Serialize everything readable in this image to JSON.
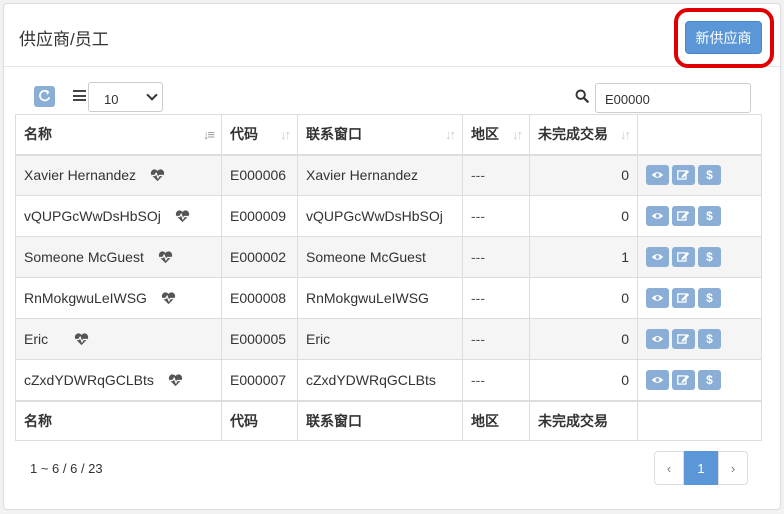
{
  "header": {
    "title": "供应商/员工",
    "new_button": "新供应商"
  },
  "toolbar": {
    "page_size": "10",
    "search_value": "E00000"
  },
  "table": {
    "columns": [
      "名称",
      "代码",
      "联系窗口",
      "地区",
      "未完成交易"
    ],
    "rows": [
      {
        "name": "Xavier Hernandez",
        "code": "E000006",
        "contact": "Xavier Hernandez",
        "region": "---",
        "open": "0"
      },
      {
        "name": "vQUPGcWwDsHbSOj",
        "code": "E000009",
        "contact": "vQUPGcWwDsHbSOj",
        "region": "---",
        "open": "0"
      },
      {
        "name": "Someone McGuest",
        "code": "E000002",
        "contact": "Someone McGuest",
        "region": "---",
        "open": "1"
      },
      {
        "name": "RnMokgwuLeIWSG",
        "code": "E000008",
        "contact": "RnMokgwuLeIWSG",
        "region": "---",
        "open": "0"
      },
      {
        "name": "Eric",
        "code": "E000005",
        "contact": "Eric",
        "region": "---",
        "open": "0"
      },
      {
        "name": "cZxdYDWRqGCLBts",
        "code": "E000007",
        "contact": "cZxdYDWRqGCLBts",
        "region": "---",
        "open": "0"
      }
    ],
    "footer": [
      "名称",
      "代码",
      "联系窗口",
      "地区",
      "未完成交易"
    ]
  },
  "pagination": {
    "summary": "1 ~ 6 / 6 / 23",
    "prev": "‹",
    "current": "1",
    "next": "›"
  },
  "icons": {
    "refresh": "refresh-icon",
    "list": "list-icon",
    "search": "search-icon",
    "heart": "heartbeat-icon",
    "view": "eye-icon",
    "edit": "edit-icon",
    "money": "dollar-icon"
  },
  "colors": {
    "primary": "#5b96d6",
    "action_button": "#8aaed5",
    "highlight": "#e00000"
  }
}
